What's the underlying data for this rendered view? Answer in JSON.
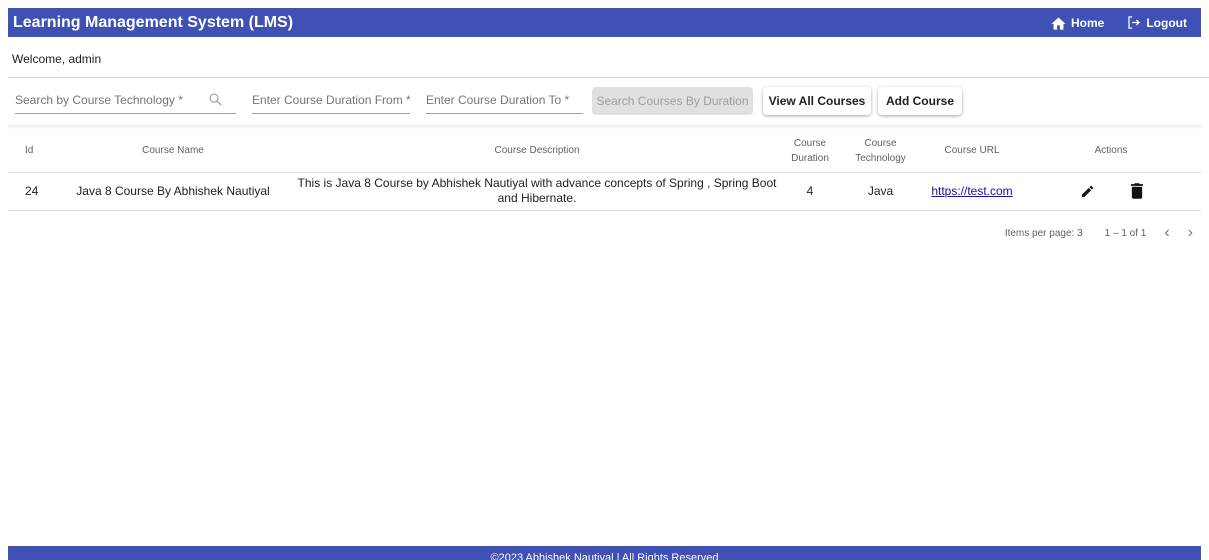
{
  "header": {
    "title": "Learning Management System (LMS)",
    "home_label": "Home",
    "logout_label": "Logout"
  },
  "welcome_text": "Welcome, admin",
  "toolbar": {
    "technology_placeholder": "Search by Course Technology *",
    "duration_from_placeholder": "Enter Course Duration From *",
    "duration_to_placeholder": "Enter Course Duration To *",
    "search_duration_label": "Search Courses By Duration",
    "view_all_label": "View All Courses",
    "add_course_label": "Add Course"
  },
  "table": {
    "headers": {
      "id": "Id",
      "name": "Course Name",
      "description": "Course Description",
      "duration_line1": "Course",
      "duration_line2": "Duration",
      "technology_line1": "Course",
      "technology_line2": "Technology",
      "url": "Course URL",
      "actions": "Actions"
    },
    "rows": [
      {
        "id": "24",
        "name": "Java 8 Course By Abhishek Nautiyal",
        "description": "This is Java 8 Course by Abhishek Nautiyal with advance concepts of Spring , Spring Boot and Hibernate.",
        "duration": "4",
        "technology": "Java",
        "url": "https://test.com"
      }
    ]
  },
  "paginator": {
    "items_per_page_label": "Items per page: 3",
    "range_label": "1 – 1 of 1"
  },
  "footer": {
    "text": "©2023 Abhishek Nautiyal | All Rights Reserved"
  },
  "colors": {
    "primary": "#3f51b5",
    "link": "#1a0dab"
  },
  "icons": [
    "home-icon",
    "logout-icon",
    "search-icon",
    "edit-icon",
    "delete-icon",
    "chevron-left-icon",
    "chevron-right-icon"
  ]
}
